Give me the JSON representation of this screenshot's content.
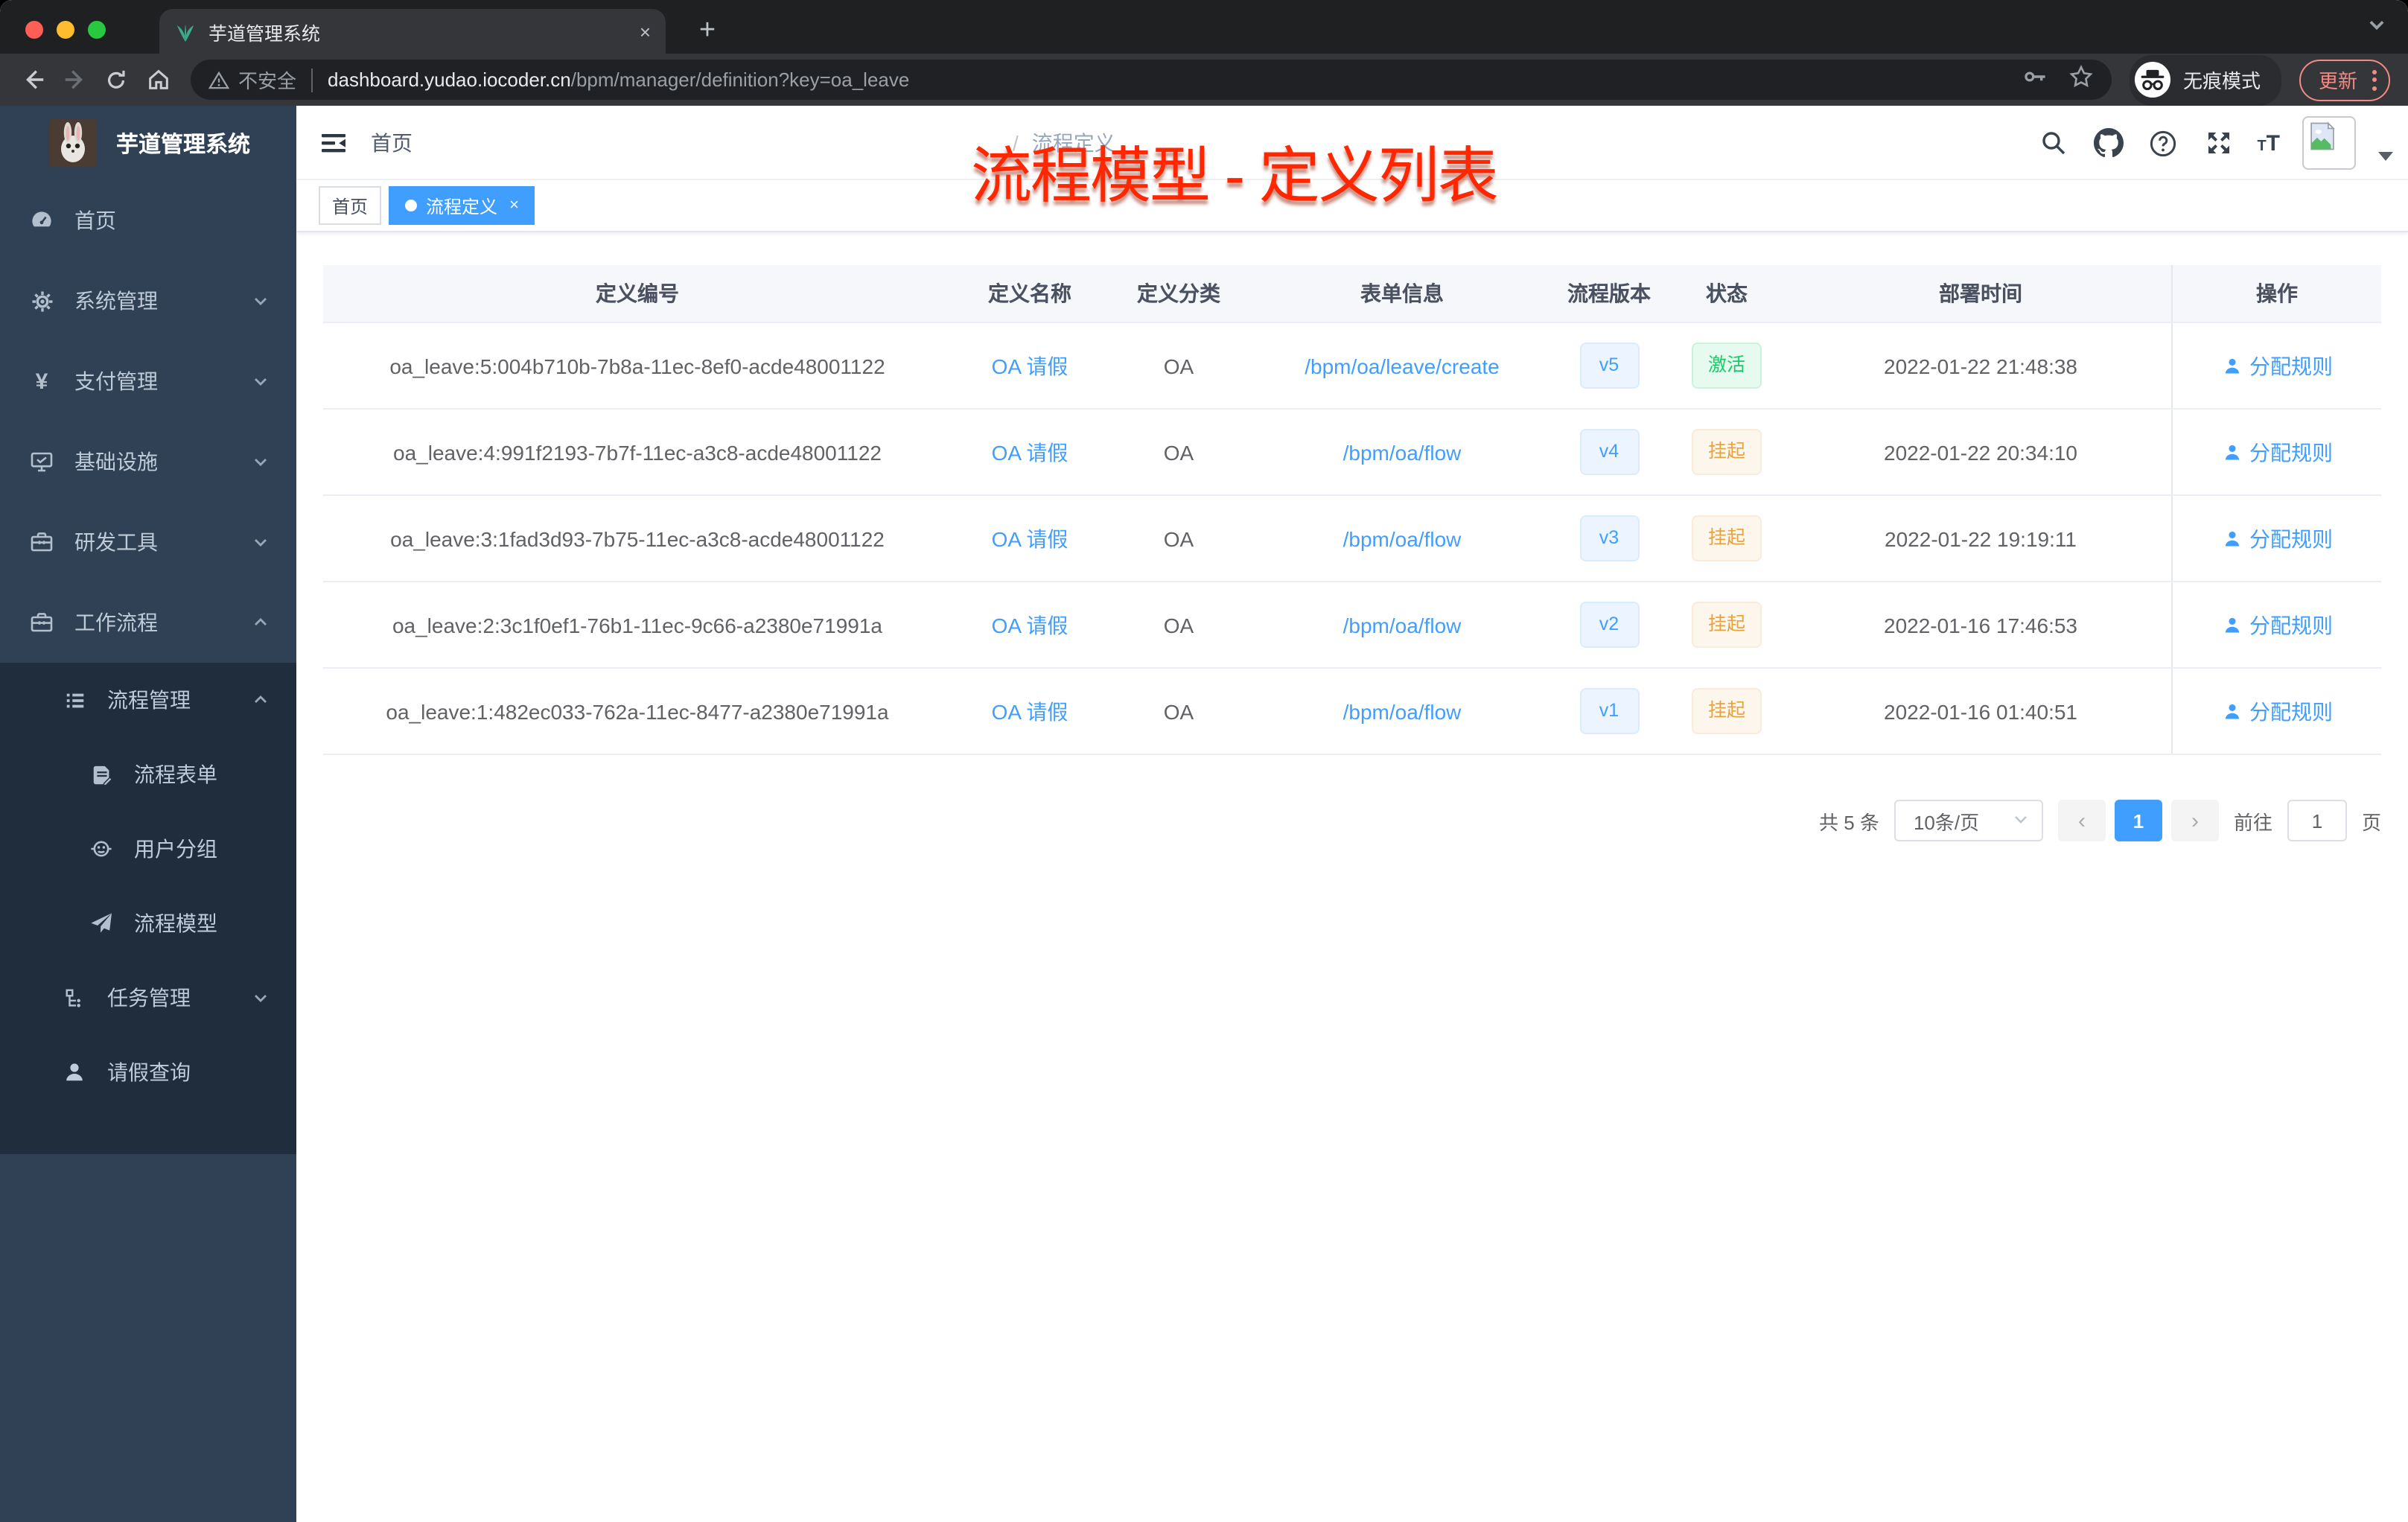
{
  "browser": {
    "tab": {
      "title": "芋道管理系统",
      "close_glyph": "×",
      "new_tab_glyph": "+"
    },
    "toolbar": {
      "security_label": "不安全",
      "url_domain": "dashboard.yudao.iocoder.cn",
      "url_path": "/bpm/manager/definition?key=oa_leave",
      "incognito_label": "无痕模式",
      "update_label": "更新"
    }
  },
  "sidebar": {
    "logo_title": "芋道管理系统",
    "items": [
      {
        "label": "首页",
        "icon": "dashboard-gauge-icon"
      },
      {
        "label": "系统管理",
        "icon": "gear-icon"
      },
      {
        "label": "支付管理",
        "icon": "yen-icon",
        "icon_glyph": "¥"
      },
      {
        "label": "基础设施",
        "icon": "monitor-icon"
      },
      {
        "label": "研发工具",
        "icon": "toolbox-icon"
      },
      {
        "label": "工作流程",
        "icon": "toolbox-icon"
      },
      {
        "label": "流程管理",
        "icon": "list-tree-icon"
      },
      {
        "label": "流程表单",
        "icon": "document-edit-icon"
      },
      {
        "label": "用户分组",
        "icon": "robot-face-icon"
      },
      {
        "label": "流程模型",
        "icon": "paper-plane-icon"
      },
      {
        "label": "任务管理",
        "icon": "branch-icon"
      },
      {
        "label": "请假查询",
        "icon": "person-icon"
      }
    ]
  },
  "navbar": {
    "breadcrumb": {
      "home": "首页",
      "separator": "/",
      "current": "流程定义"
    }
  },
  "tags": {
    "home": "首页",
    "active": "流程定义",
    "active_close_glyph": "×"
  },
  "annotation": "流程模型 - 定义列表",
  "table": {
    "headers": [
      "定义编号",
      "定义名称",
      "定义分类",
      "表单信息",
      "流程版本",
      "状态",
      "部署时间",
      "操作"
    ],
    "rows": [
      {
        "id": "oa_leave:5:004b710b-7b8a-11ec-8ef0-acde48001122",
        "name": "OA 请假",
        "category": "OA",
        "form": "/bpm/oa/leave/create",
        "version": "v5",
        "status": "激活",
        "time": "2022-01-22 21:48:38",
        "action": "分配规则"
      },
      {
        "id": "oa_leave:4:991f2193-7b7f-11ec-a3c8-acde48001122",
        "name": "OA 请假",
        "category": "OA",
        "form": "/bpm/oa/flow",
        "version": "v4",
        "status": "挂起",
        "time": "2022-01-22 20:34:10",
        "action": "分配规则"
      },
      {
        "id": "oa_leave:3:1fad3d93-7b75-11ec-a3c8-acde48001122",
        "name": "OA 请假",
        "category": "OA",
        "form": "/bpm/oa/flow",
        "version": "v3",
        "status": "挂起",
        "time": "2022-01-22 19:19:11",
        "action": "分配规则"
      },
      {
        "id": "oa_leave:2:3c1f0ef1-76b1-11ec-9c66-a2380e71991a",
        "name": "OA 请假",
        "category": "OA",
        "form": "/bpm/oa/flow",
        "version": "v2",
        "status": "挂起",
        "time": "2022-01-16 17:46:53",
        "action": "分配规则"
      },
      {
        "id": "oa_leave:1:482ec033-762a-11ec-8477-a2380e71991a",
        "name": "OA 请假",
        "category": "OA",
        "form": "/bpm/oa/flow",
        "version": "v1",
        "status": "挂起",
        "time": "2022-01-16 01:40:51",
        "action": "分配规则"
      }
    ]
  },
  "pagination": {
    "total": "共 5 条",
    "page_size": "10条/页",
    "prev_glyph": "‹",
    "next_glyph": "›",
    "page": "1",
    "goto_label": "前往",
    "goto_value": "1",
    "goto_unit": "页"
  },
  "colors": {
    "accent": "#409eff",
    "sidebar_bg": "#304156",
    "submenu_bg": "#1f2d3d",
    "status_active": "#13ce66",
    "status_suspended": "#e6a23c",
    "annotation_red": "#ff2600"
  }
}
